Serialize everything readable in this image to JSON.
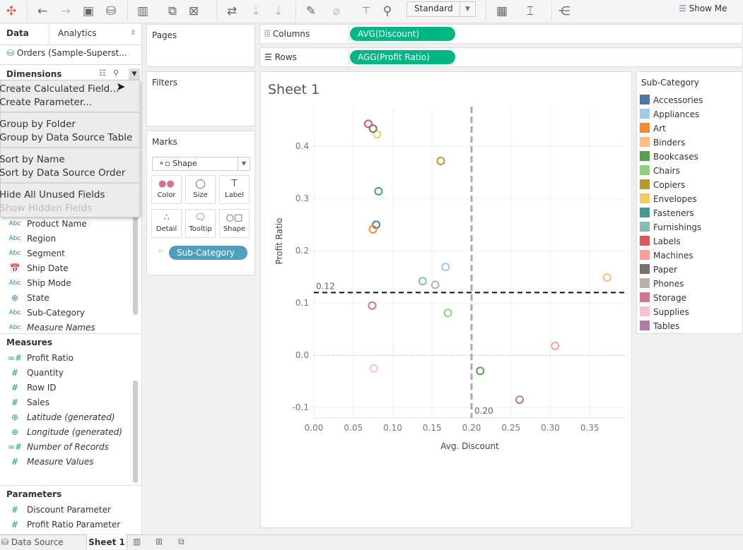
{
  "toolbar": {
    "view_mode": "Standard",
    "show_me": "Show Me"
  },
  "left_panel": {
    "tabs": [
      "Data",
      "Analytics"
    ],
    "data_source": "Orders (Sample-Superst...",
    "dimensions_title": "Dimensions",
    "dimensions": [
      {
        "icon": "Abc",
        "label": "Product Name",
        "italic": false
      },
      {
        "icon": "Abc",
        "label": "Region",
        "italic": false
      },
      {
        "icon": "Abc",
        "label": "Segment",
        "italic": false
      },
      {
        "icon": "date",
        "label": "Ship Date",
        "italic": false
      },
      {
        "icon": "Abc",
        "label": "Ship Mode",
        "italic": false
      },
      {
        "icon": "geo",
        "label": "State",
        "italic": false
      },
      {
        "icon": "Abc",
        "label": "Sub-Category",
        "italic": false
      },
      {
        "icon": "Abc",
        "label": "Measure Names",
        "italic": true
      }
    ],
    "measures_title": "Measures",
    "measures": [
      {
        "icon": "calc",
        "label": "Profit Ratio",
        "italic": false
      },
      {
        "icon": "num",
        "label": "Quantity",
        "italic": false
      },
      {
        "icon": "num",
        "label": "Row ID",
        "italic": false
      },
      {
        "icon": "num",
        "label": "Sales",
        "italic": false
      },
      {
        "icon": "geo",
        "label": "Latitude (generated)",
        "italic": true
      },
      {
        "icon": "geo",
        "label": "Longitude (generated)",
        "italic": true
      },
      {
        "icon": "calc",
        "label": "Number of Records",
        "italic": true
      },
      {
        "icon": "num",
        "label": "Measure Values",
        "italic": true
      }
    ],
    "parameters_title": "Parameters",
    "parameters": [
      {
        "label": "Discount Parameter"
      },
      {
        "label": "Profit Ratio Parameter"
      }
    ]
  },
  "menu": {
    "items": [
      {
        "label": "Create Calculated Field...",
        "enabled": true
      },
      {
        "label": "Create Parameter...",
        "enabled": true
      },
      {
        "label": "Group by Folder",
        "enabled": true
      },
      {
        "label": "Group by Data Source Table",
        "enabled": true
      },
      {
        "label": "Sort by Name",
        "enabled": true
      },
      {
        "label": "Sort by Data Source Order",
        "enabled": true
      },
      {
        "label": "Hide All Unused Fields",
        "enabled": true
      },
      {
        "label": "Show Hidden Fields",
        "enabled": false
      }
    ]
  },
  "cards": {
    "pages": "Pages",
    "filters": "Filters",
    "marks": "Marks",
    "mark_type": "Shape",
    "buttons": [
      "Color",
      "Size",
      "Label",
      "Detail",
      "Tooltip",
      "Shape"
    ],
    "color_pill": "Sub-Category"
  },
  "shelves": {
    "columns_label": "Columns",
    "columns_pill": "AVG(Discount)",
    "rows_label": "Rows",
    "rows_pill": "AGG(Profit Ratio)",
    "pill_color": "#00b783"
  },
  "sheet": {
    "title": "Sheet 1"
  },
  "legend": {
    "title": "Sub-Category"
  },
  "bottom_tabs": {
    "data_source": "Data Source",
    "sheet": "Sheet 1"
  },
  "chart_data": {
    "type": "scatter",
    "xlabel": "Avg. Discount",
    "ylabel": "Profit Ratio",
    "xlim": [
      0,
      0.3955
    ],
    "ylim": [
      -0.12,
      0.476
    ],
    "xticks": [
      "0.00",
      "0.05",
      "0.10",
      "0.15",
      "0.20",
      "0.25",
      "0.30",
      "0.35"
    ],
    "yticks": [
      "-0.1",
      "0.0",
      "0.1",
      "0.2",
      "0.3",
      "0.4"
    ],
    "reference_lines": {
      "x": 0.2,
      "x_label": "0.20",
      "y": 0.12,
      "y_label": "0.12"
    },
    "legend_placement": "right",
    "points": [
      {
        "name": "Accessories",
        "x": 0.079,
        "y": 0.25,
        "color": "#4e79a7"
      },
      {
        "name": "Appliances",
        "x": 0.167,
        "y": 0.169,
        "color": "#a0cbe8"
      },
      {
        "name": "Art",
        "x": 0.075,
        "y": 0.241,
        "color": "#f28e2b"
      },
      {
        "name": "Binders",
        "x": 0.372,
        "y": 0.149,
        "color": "#ffbe7d"
      },
      {
        "name": "Bookcases",
        "x": 0.211,
        "y": -0.03,
        "color": "#59a14f"
      },
      {
        "name": "Chairs",
        "x": 0.17,
        "y": 0.081,
        "color": "#8cd17d"
      },
      {
        "name": "Copiers",
        "x": 0.161,
        "y": 0.372,
        "color": "#b6992d"
      },
      {
        "name": "Envelopes",
        "x": 0.08,
        "y": 0.423,
        "color": "#f1ce63"
      },
      {
        "name": "Fasteners",
        "x": 0.082,
        "y": 0.314,
        "color": "#499894"
      },
      {
        "name": "Furnishings",
        "x": 0.138,
        "y": 0.142,
        "color": "#86bcb6"
      },
      {
        "name": "Labels",
        "x": 0.069,
        "y": 0.443,
        "color": "#e15759"
      },
      {
        "name": "Machines",
        "x": 0.306,
        "y": 0.018,
        "color": "#ff9d9a"
      },
      {
        "name": "Paper",
        "x": 0.075,
        "y": 0.434,
        "color": "#79706e"
      },
      {
        "name": "Phones",
        "x": 0.154,
        "y": 0.135,
        "color": "#bab0ac"
      },
      {
        "name": "Storage",
        "x": 0.074,
        "y": 0.095,
        "color": "#d37295"
      },
      {
        "name": "Supplies",
        "x": 0.076,
        "y": -0.025,
        "color": "#fabfd2"
      },
      {
        "name": "Tables",
        "x": 0.261,
        "y": -0.085,
        "color": "#b07aa1"
      }
    ]
  }
}
